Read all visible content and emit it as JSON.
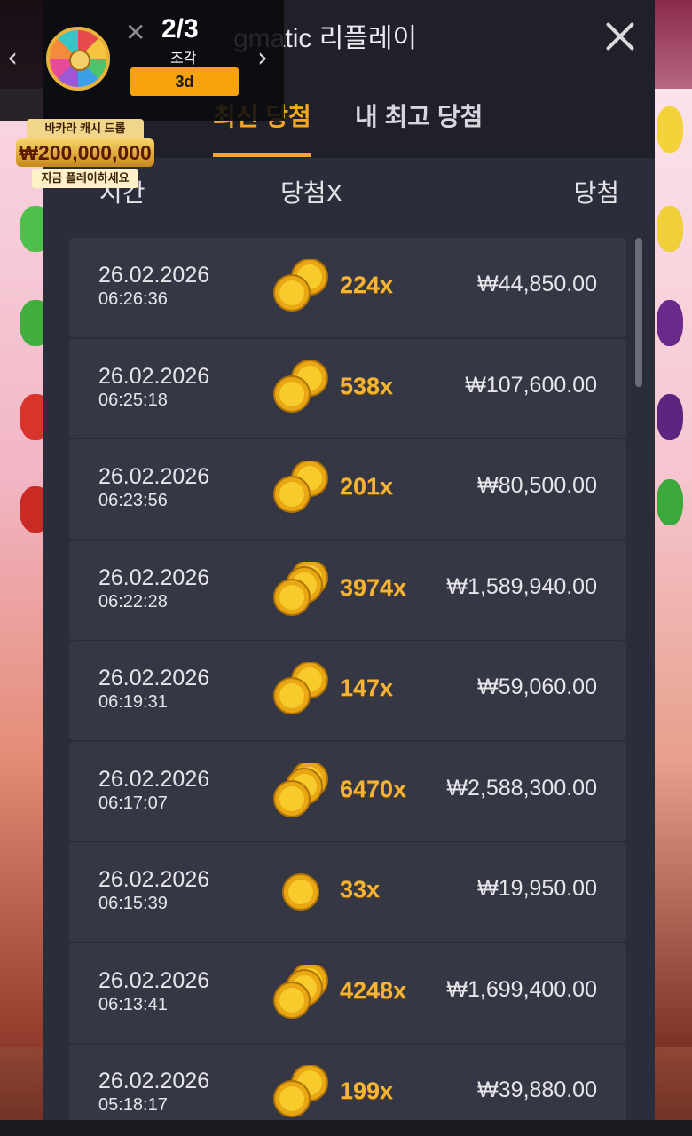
{
  "header": {
    "title": "Pragmatic 리플레이",
    "visible_title": "gmatic 리플레이"
  },
  "tabs": [
    {
      "label": "최신 당첨",
      "active": true
    },
    {
      "label": "내 최고 당첨",
      "active": false
    }
  ],
  "columns": {
    "time": "시간",
    "multiplier": "당첨X",
    "win": "당첨"
  },
  "rows": [
    {
      "date": "26.02.2026",
      "time": "06:26:36",
      "multiplier": "224x",
      "amount": "₩44,850.00"
    },
    {
      "date": "26.02.2026",
      "time": "06:25:18",
      "multiplier": "538x",
      "amount": "₩107,600.00"
    },
    {
      "date": "26.02.2026",
      "time": "06:23:56",
      "multiplier": "201x",
      "amount": "₩80,500.00"
    },
    {
      "date": "26.02.2026",
      "time": "06:22:28",
      "multiplier": "3974x",
      "amount": "₩1,589,940.00"
    },
    {
      "date": "26.02.2026",
      "time": "06:19:31",
      "multiplier": "147x",
      "amount": "₩59,060.00"
    },
    {
      "date": "26.02.2026",
      "time": "06:17:07",
      "multiplier": "6470x",
      "amount": "₩2,588,300.00"
    },
    {
      "date": "26.02.2026",
      "time": "06:15:39",
      "multiplier": "33x",
      "amount": "₩19,950.00"
    },
    {
      "date": "26.02.2026",
      "time": "06:13:41",
      "multiplier": "4248x",
      "amount": "₩1,699,400.00"
    },
    {
      "date": "26.02.2026",
      "time": "05:18:17",
      "multiplier": "199x",
      "amount": "₩39,880.00"
    }
  ],
  "promo": {
    "progress": "2/3",
    "progress_label": "조각",
    "days": "3d",
    "cash_title": "바카라 캐시 드롭",
    "cash_amount": "₩200,000,000",
    "cash_cta": "지금 플레이하세요"
  },
  "colors": {
    "accent": "#f5a623",
    "panel": "#2b2d3a",
    "row": "#353745",
    "multiplier": "#f6b437"
  }
}
